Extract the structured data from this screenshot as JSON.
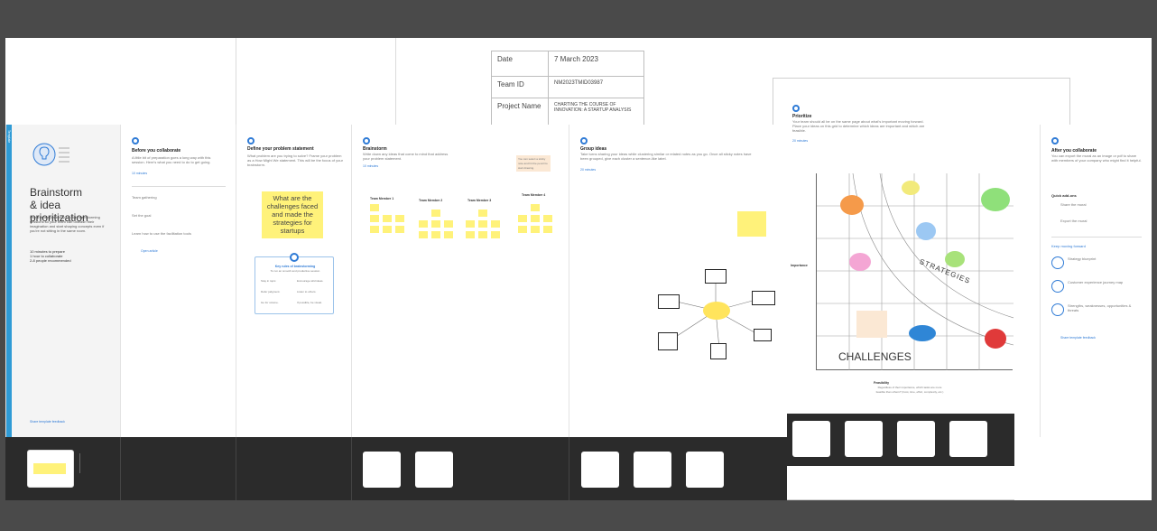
{
  "info_table": {
    "date_label": "Date",
    "date_value": "7 March 2023",
    "team_label": "Team ID",
    "team_value": "NM2023TMID03987",
    "project_label": "Project Name",
    "project_value": "CHARTING THE COURSE OF INNOVATION: A STARTUP ANALYSIS"
  },
  "template_tab": "Template",
  "intro": {
    "title_line1": "Brainstorm",
    "title_line2": "& idea prioritization",
    "description": "Use this template in your own brainstorming sessions so your team can unleash their imagination and start shaping concepts even if you're not sitting in the same room.",
    "meta1": "10 minutes to prepare",
    "meta2": "1 hour to collaborate",
    "meta3": "2-8 people recommended",
    "footer_link": "Share template feedback"
  },
  "before": {
    "title": "Before you collaborate",
    "desc": "A little bit of preparation goes a long way with this session. Here's what you need to do to get going.",
    "time": "10 minutes",
    "stepA": "Team gathering",
    "stepB": "Set the goal",
    "stepC": "Learn how to use the facilitation tools",
    "open_link": "Open article"
  },
  "step1": {
    "title": "Define your problem statement",
    "desc": "What problem are you trying to solve? Frame your problem as a How Might We statement. This will be the focus of your brainstorm.",
    "sticky": "What are the challenges faced and made the strategies for startups",
    "tips_title": "Key rules of brainstorming",
    "tips_sub": "To run an smooth and productive session",
    "rule1": "Stay in topic.",
    "rule2": "Encourage wild ideas.",
    "rule3": "Defer judgment.",
    "rule4": "Listen to others.",
    "rule5": "Go for volume.",
    "rule6": "If possible, be visual."
  },
  "step2": {
    "title": "Brainstorm",
    "desc": "Write down any ideas that come to mind that address your problem statement.",
    "time": "10 minutes",
    "members": [
      "Team Member 1",
      "Team Member 2",
      "Team Member 3",
      "Team Member 4"
    ],
    "tip": "You can select a sticky note and hit the pencil to start drawing."
  },
  "step3": {
    "title": "Group ideas",
    "desc": "Take turns sharing your ideas while clustering similar or related notes as you go. Once all sticky notes have been grouped, give each cluster a sentence-like label.",
    "time": "20 minutes"
  },
  "step4": {
    "title": "Prioritize",
    "desc": "Your team should all be on the same page about what's important moving forward. Place your ideas on this grid to determine which ideas are important and which are feasible.",
    "time": "20 minutes",
    "strategies": "STRATEGIES",
    "challenges": "CHALLENGES",
    "yaxis": "Importance",
    "xaxis": "Feasibility",
    "feas_note": "Regardless of their importance, which tasks are more feasible than others? (Cost, time, effort, complexity, etc.)"
  },
  "after": {
    "title": "After you collaborate",
    "desc": "You can export the mural as an image or pdf to share with members of your company who might find it helpful.",
    "quick_add": "Quick add-ons",
    "qa1": "Share the mural",
    "qa2": "Export the mural",
    "keep": "Keep moving forward",
    "k1": "Strategy blueprint",
    "k2": "Customer experience journey map",
    "k3": "Strengths, weaknesses, opportunities & threats",
    "footer_link": "Share template feedback"
  },
  "colors": {
    "accent": "#2f7bd6",
    "sticky": "#fff27a",
    "frame": "#2b2b2b",
    "background": "#4a4a4a"
  }
}
